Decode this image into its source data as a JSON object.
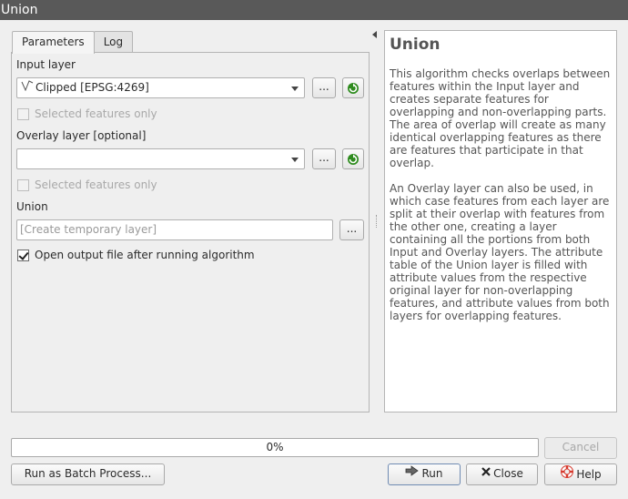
{
  "window": {
    "title": "Union"
  },
  "tabs": [
    {
      "label": "Parameters",
      "active": true
    },
    {
      "label": "Log",
      "active": false
    }
  ],
  "params": {
    "input_layer_label": "Input layer",
    "input_layer_value": "Clipped [EPSG:4269]",
    "input_layer_icon": "line-layer-icon",
    "browse_label": "...",
    "selected_only_label": "Selected features only",
    "overlay_layer_label": "Overlay layer [optional]",
    "overlay_layer_value": "",
    "overlay_selected_only_label": "Selected features only",
    "output_label": "Union",
    "output_placeholder": "[Create temporary layer]",
    "open_output_label": "Open output file after running algorithm",
    "open_output_checked": true
  },
  "help": {
    "title": "Union",
    "paragraphs": [
      "This algorithm checks overlaps between features within the Input layer and creates separate features for overlapping and non-overlapping parts. The area of overlap will create as many identical overlapping features as there are features that participate in that overlap.",
      "An Overlay layer can also be used, in which case features from each layer are split at their overlap with features from the other one, creating a layer containing all the portions from both Input and Overlay layers. The attribute table of the Union layer is filled with attribute values from the respective original layer for non-overlapping features, and attribute values from both layers for overlapping features."
    ]
  },
  "progress": {
    "text": "0%",
    "value": 0
  },
  "buttons": {
    "cancel": "Cancel",
    "batch": "Run as Batch Process...",
    "run": "Run",
    "close": "Close",
    "help": "Help"
  },
  "colors": {
    "titlebar": "#595959",
    "refresh_icon": "#2e8b1e",
    "help_icon": "#d63a2e"
  }
}
